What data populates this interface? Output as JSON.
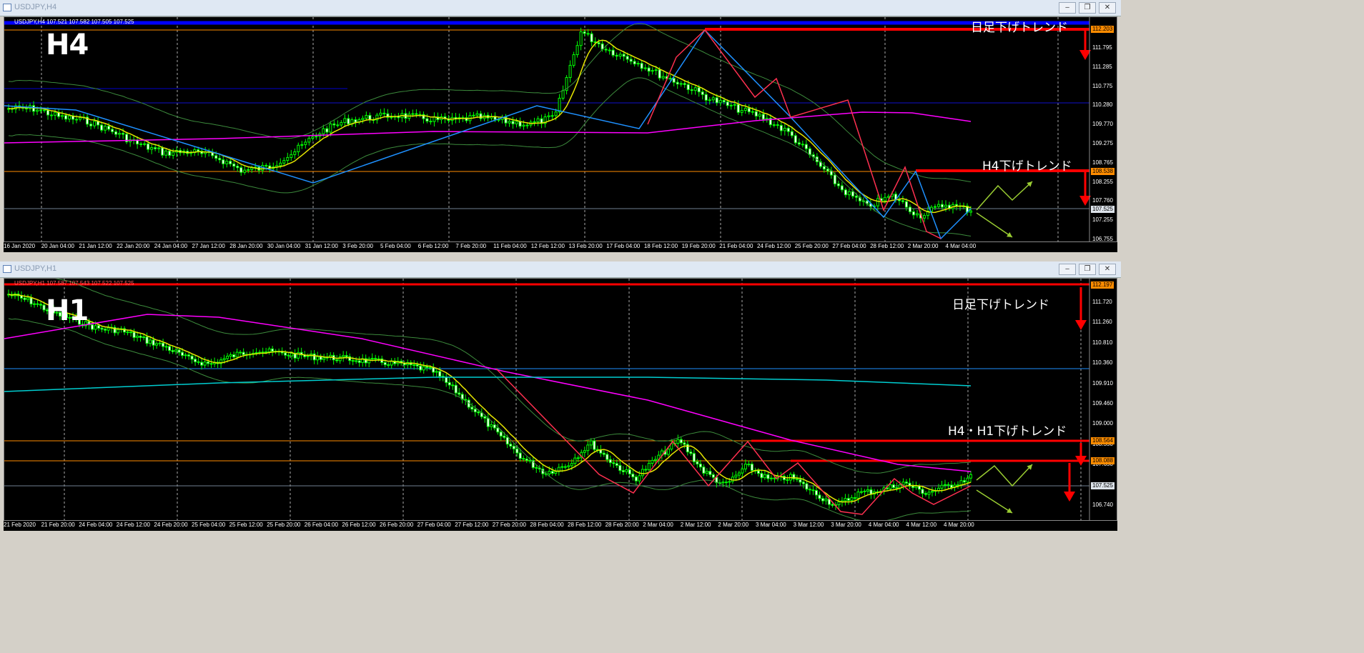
{
  "top": {
    "title": "USDJPY,H4",
    "info": "USDJPY,H4  107.521 107.582 107.505 107.525",
    "label": "H4",
    "annotation_daily": "日足下げトレンド",
    "annotation_trend": "H4下げトレンド",
    "y_labels": [
      "111.795",
      "111.285",
      "110.775",
      "110.280",
      "109.770",
      "109.275",
      "108.765",
      "108.255",
      "107.760",
      "107.255",
      "106.755"
    ],
    "price_boxes": [
      "112.203",
      "108.538",
      "107.525"
    ],
    "x_labels": [
      "16 Jan 2020",
      "20 Jan 04:00",
      "21 Jan 12:00",
      "22 Jan 20:00",
      "24 Jan 04:00",
      "27 Jan 12:00",
      "28 Jan 20:00",
      "30 Jan 04:00",
      "31 Jan 12:00",
      "3 Feb 20:00",
      "5 Feb 04:00",
      "6 Feb 12:00",
      "7 Feb 20:00",
      "11 Feb 04:00",
      "12 Feb 12:00",
      "13 Feb 20:00",
      "17 Feb 04:00",
      "18 Feb 12:00",
      "19 Feb 20:00",
      "21 Feb 04:00",
      "24 Feb 12:00",
      "25 Feb 20:00",
      "27 Feb 04:00",
      "28 Feb 12:00",
      "2 Mar 20:00",
      "4 Mar 04:00"
    ]
  },
  "bottom": {
    "title": "USDJPY,H1",
    "info": "USDJPY,H1  107.587 107.543 107.522 107.525",
    "label": "H1",
    "annotation_daily": "日足下げトレンド",
    "annotation_trend": "H4・H1下げトレンド",
    "y_labels": [
      "111.720",
      "111.260",
      "110.810",
      "110.360",
      "109.910",
      "109.460",
      "109.000",
      "108.550",
      "107.650",
      "107.190",
      "106.740"
    ],
    "price_boxes": [
      "112.197",
      "108.564",
      "108.088",
      "107.525"
    ],
    "x_labels": [
      "21 Feb 2020",
      "21 Feb 20:00",
      "24 Feb 04:00",
      "24 Feb 12:00",
      "24 Feb 20:00",
      "25 Feb 04:00",
      "25 Feb 12:00",
      "25 Feb 20:00",
      "26 Feb 04:00",
      "26 Feb 12:00",
      "26 Feb 20:00",
      "27 Feb 04:00",
      "27 Feb 12:00",
      "27 Feb 20:00",
      "28 Feb 04:00",
      "28 Feb 12:00",
      "28 Feb 20:00",
      "2 Mar 04:00",
      "2 Mar 12:00",
      "2 Mar 20:00",
      "3 Mar 04:00",
      "3 Mar 12:00",
      "3 Mar 20:00",
      "4 Mar 04:00",
      "4 Mar 12:00",
      "4 Mar 20:00"
    ]
  },
  "buttons": {
    "minimize": "‒",
    "restore": "❐",
    "close": "✕"
  },
  "colors": {
    "background": "#000000",
    "candle_up": "#00ff00",
    "ma_yellow": "#ffff00",
    "ma_magenta": "#ff00ff",
    "trend_cyan": "#1e90ff",
    "resistance_red": "#ff0000",
    "arrow_green": "#9acd32"
  }
}
